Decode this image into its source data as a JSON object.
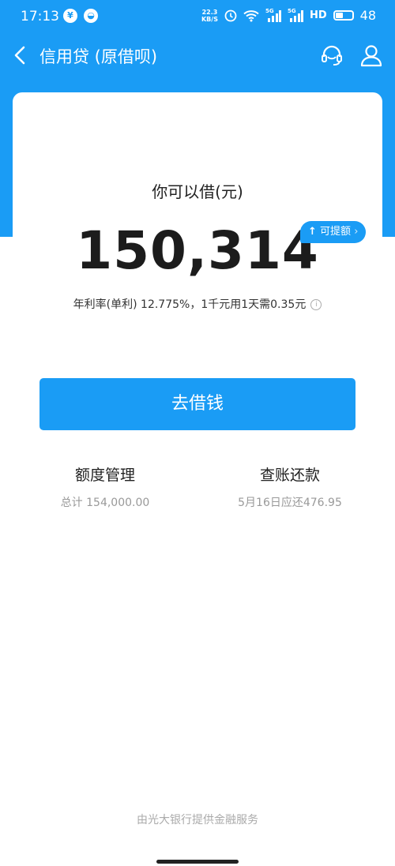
{
  "status_bar": {
    "time": "17:13",
    "net_speed_value": "22.3",
    "net_speed_unit": "KB/S",
    "signal1": "5G",
    "signal2": "5G",
    "hd": "HD",
    "battery": "48"
  },
  "nav": {
    "title": "信用贷 (原借呗)"
  },
  "loan": {
    "label": "你可以借(元)",
    "amount": "150,314",
    "raise_badge": "可提额",
    "rate_text": "年利率(单利) 12.775%，1千元用1天需0.35元"
  },
  "actions": {
    "borrow_button": "去借钱",
    "quota_title": "额度管理",
    "quota_sub": "总计 154,000.00",
    "repay_title": "查账还款",
    "repay_sub": "5月16日应还476.95"
  },
  "footer": {
    "text": "由光大银行提供金融服务"
  },
  "colors": {
    "brand_blue": "#1a9cf5"
  }
}
